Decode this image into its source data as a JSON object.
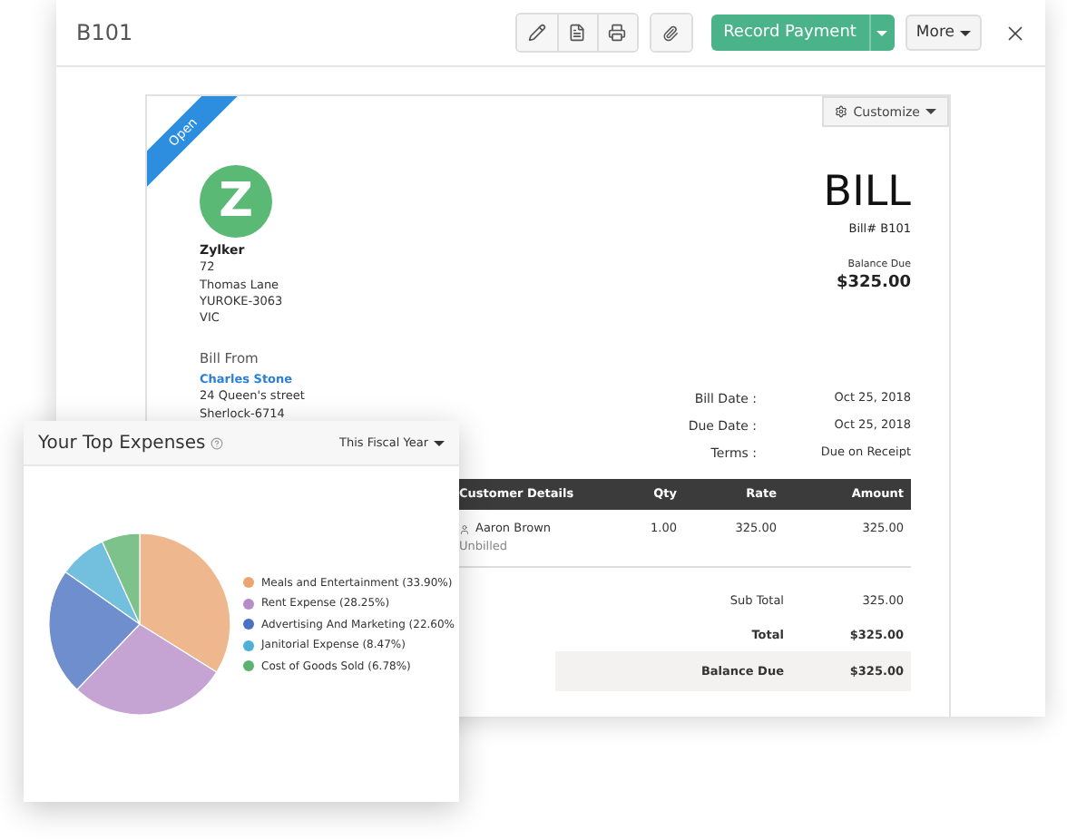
{
  "window": {
    "title": "B101"
  },
  "toolbar": {
    "primary_button": "Record Payment",
    "more_button": "More"
  },
  "bill": {
    "status_ribbon": "Open",
    "customize_button": "Customize",
    "logo_letter": "Z",
    "company": {
      "name": "Zylker",
      "address": [
        "72",
        "Thomas Lane",
        "YUROKE-3063",
        "VIC"
      ]
    },
    "heading": "BILL",
    "number": "Bill# B101",
    "balance_label": "Balance Due",
    "balance_amount": "$325.00",
    "bill_from": {
      "label": "Bill From",
      "vendor": "Charles Stone",
      "address": [
        "24 Queen's street",
        "Sherlock-6714"
      ]
    },
    "dates": [
      {
        "label": "Bill Date :",
        "value": "Oct 25, 2018"
      },
      {
        "label": "Due Date :",
        "value": "Oct 25, 2018"
      },
      {
        "label": "Terms :",
        "value": "Due on Receipt"
      }
    ],
    "table": {
      "columns": [
        "Customer Details",
        "Qty",
        "Rate",
        "Amount"
      ],
      "rows": [
        {
          "customer": "Aaron Brown",
          "note": "Unbilled",
          "qty": "1.00",
          "rate": "325.00",
          "amount": "325.00"
        }
      ]
    },
    "totals": [
      {
        "label": "Sub Total",
        "value": "325.00",
        "kind": "plain"
      },
      {
        "label": "Total",
        "value": "$325.00",
        "kind": "bold"
      },
      {
        "label": "Balance Due",
        "value": "$325.00",
        "kind": "band"
      }
    ]
  },
  "expenses_card": {
    "title": "Your Top Expenses",
    "period": "This Fiscal Year",
    "legend": [
      {
        "color": "#eba572"
      },
      {
        "color": "#b68dc8"
      },
      {
        "color": "#4a72c2"
      },
      {
        "color": "#4fb0d6"
      },
      {
        "color": "#5cb36e"
      }
    ],
    "chart_data": {
      "type": "pie",
      "categories": [
        "Meals and Entertainment (33.90%)",
        "Rent Expense (28.25%)",
        "Advertising And Marketing (22.60%",
        "Janitorial Expense (8.47%)",
        "Cost of Goods Sold (6.78%)"
      ],
      "values": [
        33.9,
        28.25,
        22.6,
        8.47,
        6.78
      ]
    }
  }
}
